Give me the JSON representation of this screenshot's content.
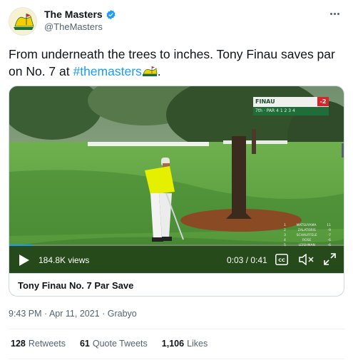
{
  "author": {
    "name": "The Masters",
    "handle": "@TheMasters",
    "verified": true
  },
  "tweet": {
    "text_before": "From underneath the trees to inches. Tony Finau saves par on No. 7 at ",
    "hashtag": "#themasters",
    "text_after": "."
  },
  "video": {
    "scorebug": {
      "player": "FINAU",
      "score": "-2",
      "hole_info": "7th · PAR 4   1 2 3 4"
    },
    "leaderboard": [
      {
        "pos": "1",
        "name": "MATSUYAMA",
        "score": "11"
      },
      {
        "pos": "2",
        "name": "ZALATORIS",
        "score": "-9"
      },
      {
        "pos": "3",
        "name": "SCHAUFFELE",
        "score": "-7"
      },
      {
        "pos": "4",
        "name": "ROSE",
        "score": "-6"
      },
      {
        "pos": "5",
        "name": "LEISHMAN",
        "score": "-6"
      }
    ],
    "views": "184.8K views",
    "time": "0:03 / 0:41",
    "cc_label": "CC",
    "progress": 0.07
  },
  "media_caption": "Tony Finau No. 7 Par Save",
  "meta": {
    "timestamp": "9:43 PM · Apr 11, 2021 · Grabyo"
  },
  "stats": {
    "retweets_count": "128",
    "retweets_label": "Retweets",
    "quotes_count": "61",
    "quotes_label": "Quote Tweets",
    "likes_count": "1,106",
    "likes_label": "Likes"
  },
  "colors": {
    "accent": "#1d9bf0",
    "masters_green": "#1f6d38",
    "masters_yellow": "#f2d000"
  },
  "icons": [
    "masters-logo-icon",
    "verified-badge-icon",
    "more-options-icon",
    "play-icon",
    "closed-captions-icon",
    "mute-icon",
    "fullscreen-icon"
  ]
}
